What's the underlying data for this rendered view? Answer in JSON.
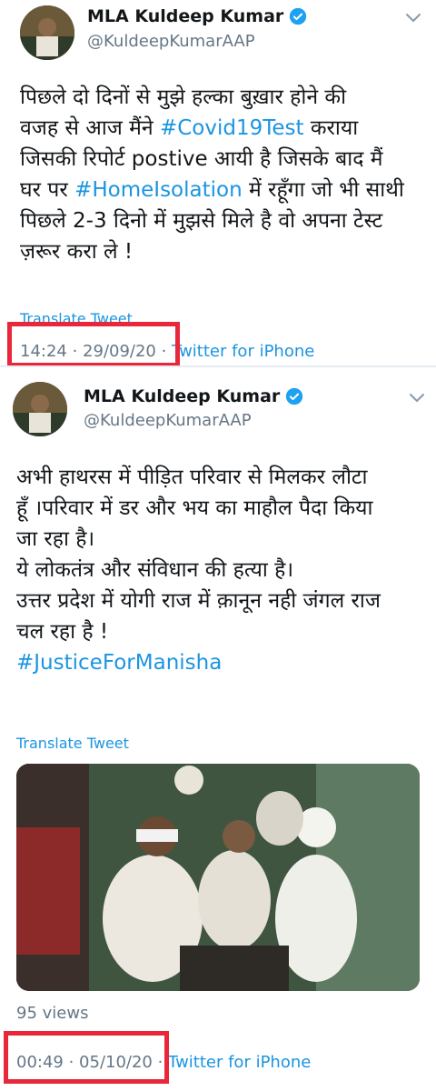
{
  "tweets": [
    {
      "author_name": "MLA Kuldeep Kumar",
      "handle": "@KuldeepKumarAAP",
      "text_lines": [
        [
          {
            "t": "पिछले दो दिनों से मुझे हल्का बुख़ार होने की"
          }
        ],
        [
          {
            "t": "वजह से आज मैंने "
          },
          {
            "t": "#Covid19Test",
            "tag": true
          },
          {
            "t": " कराया"
          }
        ],
        [
          {
            "t": "जिसकी रिपोर्ट postive आयी है जिसके बाद मैं"
          }
        ],
        [
          {
            "t": "घर पर "
          },
          {
            "t": "#HomeIsolation",
            "tag": true
          },
          {
            "t": " में रहूँगा जो भी साथी"
          }
        ],
        [
          {
            "t": "पिछले 2-3 दिनो में मुझसे मिले है वो अपना टेस्ट"
          }
        ],
        [
          {
            "t": "ज़रूर करा ले !"
          }
        ]
      ],
      "translate": "Translate Tweet",
      "time": "14:24 · 29/09/20 · ",
      "source": "Twitter for iPhone"
    },
    {
      "author_name": "MLA Kuldeep Kumar",
      "handle": "@KuldeepKumarAAP",
      "text_lines": [
        [
          {
            "t": "अभी हाथरस में पीड़ित परिवार से मिलकर लौटा"
          }
        ],
        [
          {
            "t": "हूँ ।परिवार में डर और भय का माहौल पैदा किया"
          }
        ],
        [
          {
            "t": "जा रहा है।"
          }
        ],
        [
          {
            "t": "ये लोकतंत्र और संविधान की हत्या है।"
          }
        ],
        [
          {
            "t": "उत्तर प्रदेश में योगी राज में क़ानून नही जंगल राज"
          }
        ],
        [
          {
            "t": "चल रहा है !"
          }
        ],
        [
          {
            "t": "#JusticeForManisha",
            "tag": true
          }
        ]
      ],
      "translate": "Translate Tweet",
      "views": "95 views",
      "time": "00:49 · 05/10/20 · ",
      "source": "Twitter for iPhone"
    }
  ],
  "icons": {
    "verified": "verified-badge-icon",
    "more": "chevron-down-icon"
  },
  "colors": {
    "link": "#1b95e0",
    "muted": "#657786",
    "highlight_box": "#e8283a",
    "verified": "#1da1f2"
  }
}
